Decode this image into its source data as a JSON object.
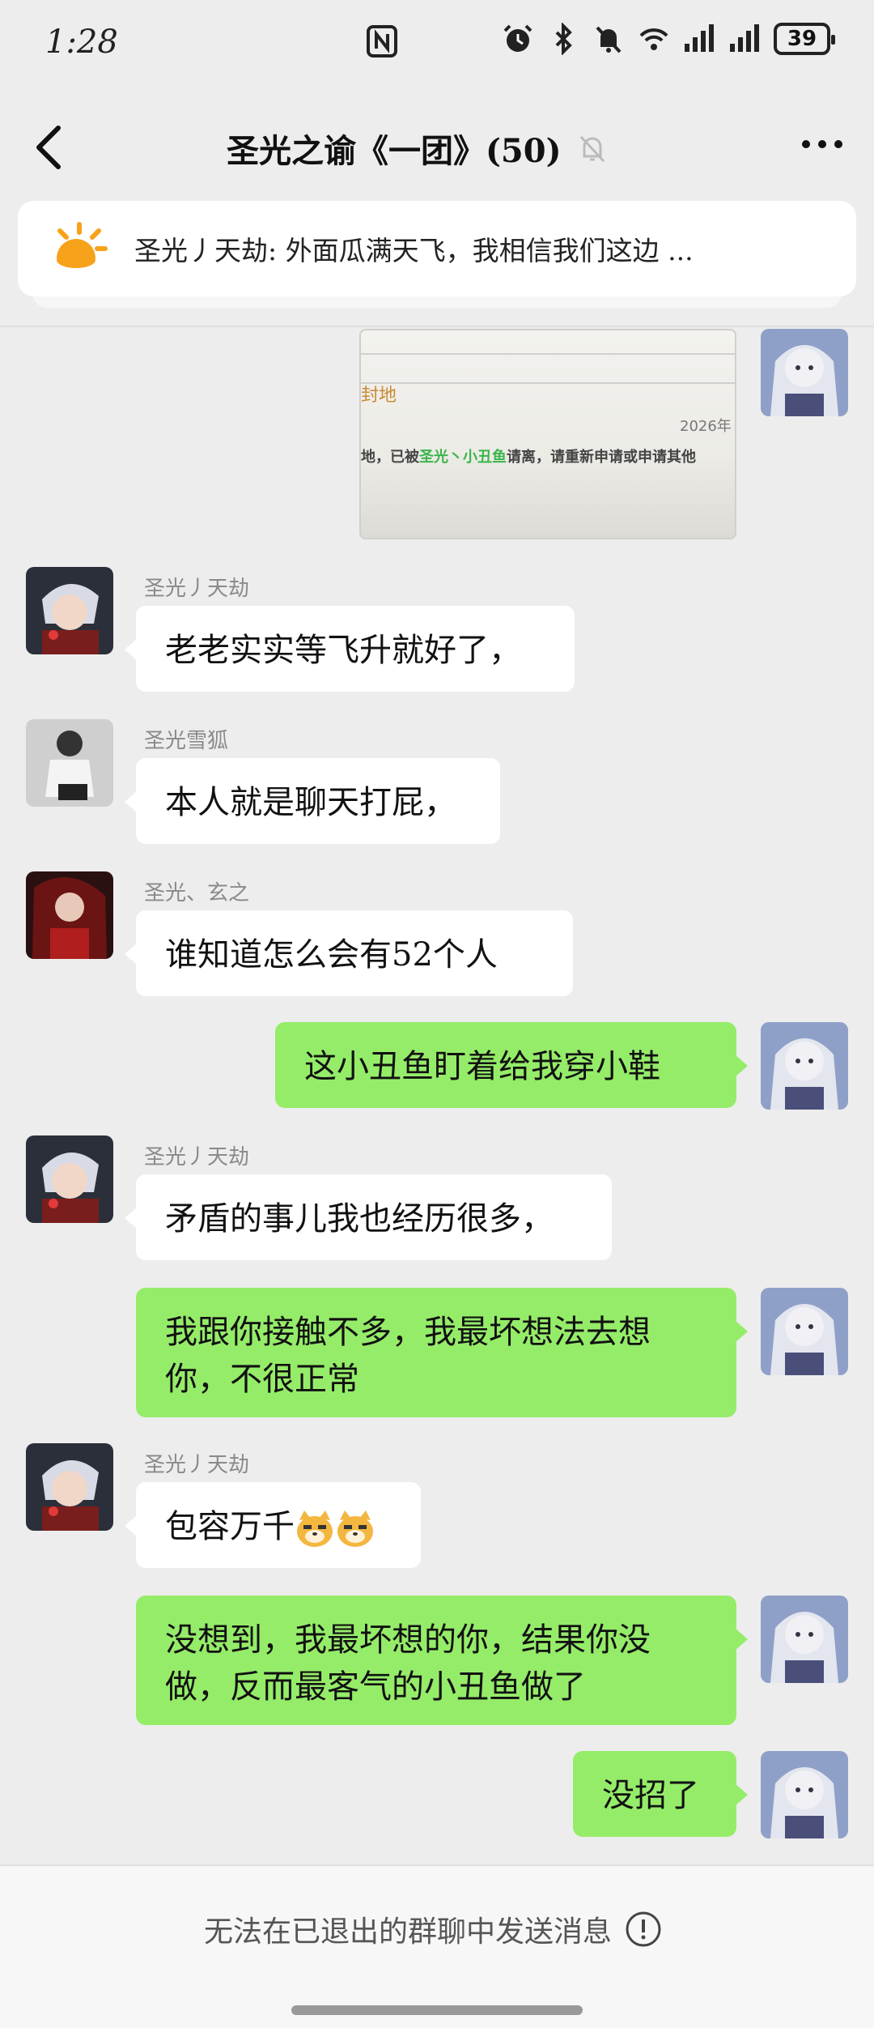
{
  "status": {
    "time": "1:28",
    "battery": "39",
    "icons": [
      "nfc-icon",
      "alarm-icon",
      "bluetooth-icon",
      "mute-bell-icon",
      "wifi-6-icon",
      "signal-icon",
      "signal-icon"
    ]
  },
  "header": {
    "title": "圣光之谕《一团》(50)",
    "back_icon": "chevron-left-icon",
    "more_icon": "more-dots-icon",
    "mute_icon": "mute-bell-icon"
  },
  "pinned": {
    "icon": "sun-announcement-icon",
    "text": "圣光丿天劫: 外面瓜满天飞，我相信我们这边 ..."
  },
  "image_message": {
    "fragment_title": "封地",
    "fragment_date": "2026年",
    "fragment_prefix": "地，已被",
    "fragment_name": "圣光丶小丑鱼",
    "fragment_suffix": "请离，请重新申请或申请其他"
  },
  "messages": [
    {
      "sender": "圣光丿天劫",
      "text": "老老实实等飞升就好了，",
      "direction": "in"
    },
    {
      "sender": "圣光雪狐",
      "text": "本人就是聊天打屁，",
      "direction": "in"
    },
    {
      "sender": "圣光、玄之",
      "text": "谁知道怎么会有52个人",
      "direction": "in"
    },
    {
      "text": "这小丑鱼盯着给我穿小鞋",
      "direction": "out"
    },
    {
      "sender": "圣光丿天劫",
      "text": "矛盾的事儿我也经历很多，",
      "direction": "in"
    },
    {
      "text_line1": "我跟你接触不多，我最坏想法去想",
      "text_line2": "你，不很正常",
      "direction": "out"
    },
    {
      "sender": "圣光丿天劫",
      "text": "包容万千",
      "emoji": "doge-emoji",
      "direction": "in"
    },
    {
      "text_line1": "没想到，我最坏想的你，结果你没",
      "text_line2": "做，反而最客气的小丑鱼做了",
      "direction": "out"
    },
    {
      "text": "没招了",
      "direction": "out"
    }
  ],
  "footer": {
    "text": "无法在已退出的群聊中发送消息",
    "icon": "info-circle-icon"
  },
  "colors": {
    "background": "#ededed",
    "outgoing_bubble": "#95ec69",
    "incoming_bubble": "#ffffff",
    "sender_name": "#8a8a8a",
    "highlight_green": "#3bb54a"
  }
}
